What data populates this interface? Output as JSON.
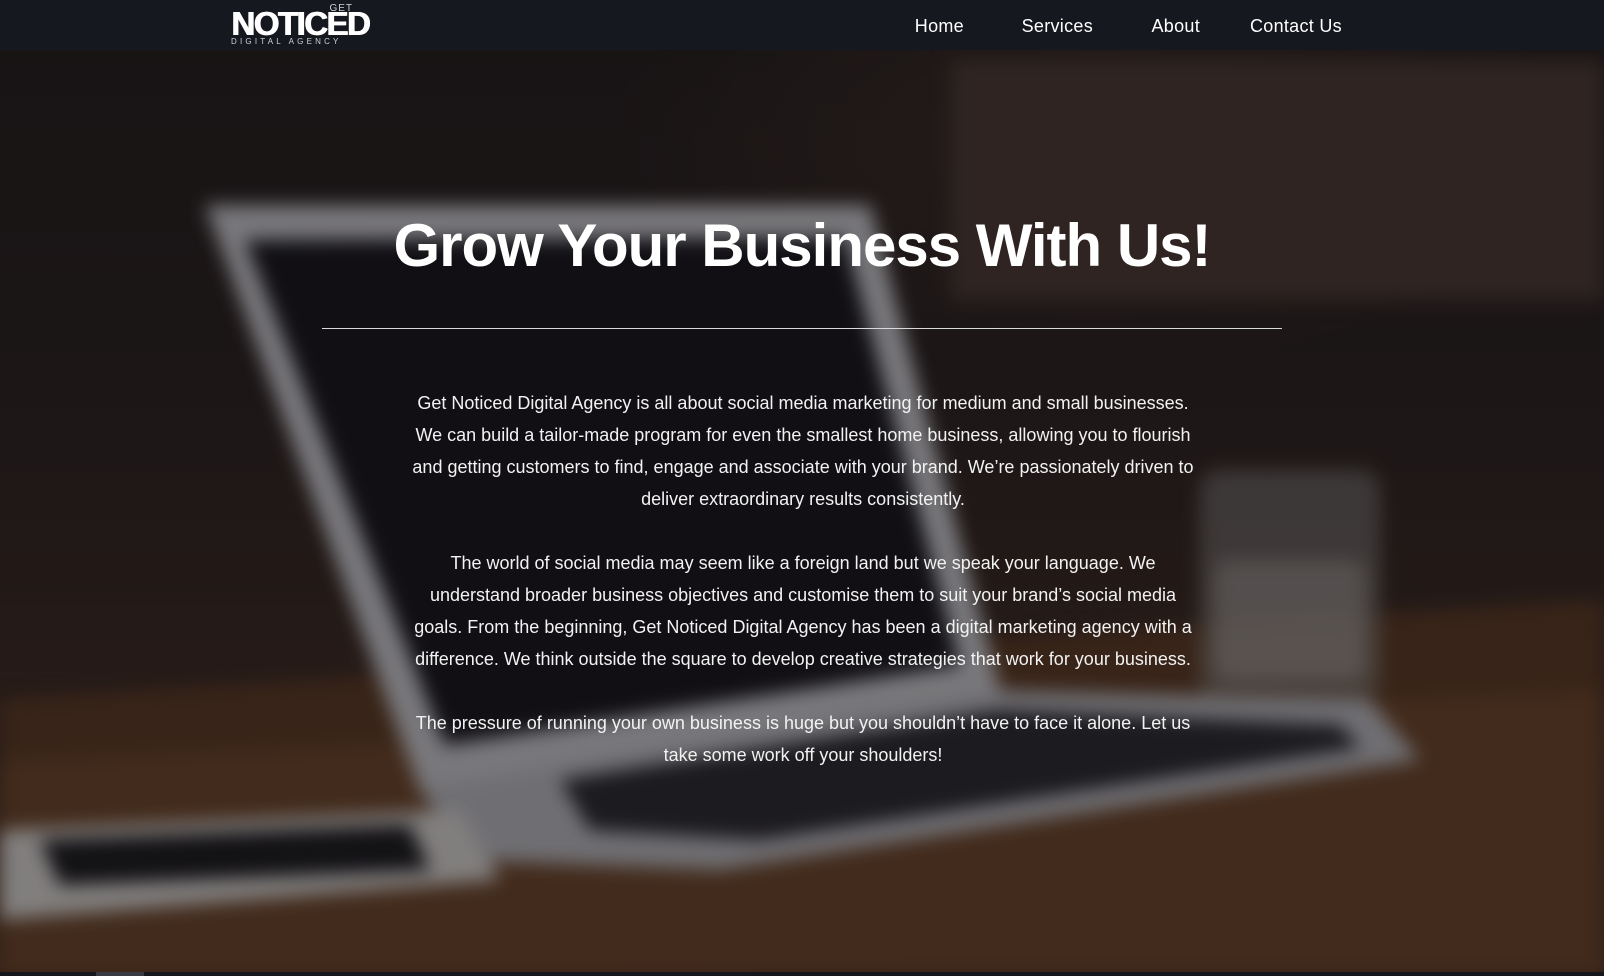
{
  "brand": {
    "logo_top": "GET",
    "logo_main": "NOTICED",
    "logo_sub": "DIGITAL AGENCY"
  },
  "nav": {
    "items": [
      {
        "label": "Home"
      },
      {
        "label": "Services"
      },
      {
        "label": "About"
      },
      {
        "label": "Contact Us"
      }
    ]
  },
  "hero": {
    "title": "Grow Your Business With Us!",
    "paragraphs": [
      "Get Noticed Digital Agency is all about social media marketing for medium and small businesses. We can build a tailor-made program for even the smallest home business, allowing you to flourish and getting customers to find, engage and associate with your brand. We’re passionately driven to deliver extraordinary results consistently.",
      "The world of social media may seem like a foreign land but we speak your language. We understand broader business objectives and customise them to suit your brand’s social media goals. From the beginning, Get Noticed Digital Agency has been a digital marketing agency with a difference. We think outside the square to develop creative strategies that work for your business.",
      "The pressure of running your own business is huge but you shouldn’t have to face it alone. Let us take some work off your shoulders!"
    ]
  },
  "colors": {
    "header_bg": "#15181f",
    "text": "#ffffff",
    "overlay": "rgba(10, 8, 12, 0.42)"
  }
}
